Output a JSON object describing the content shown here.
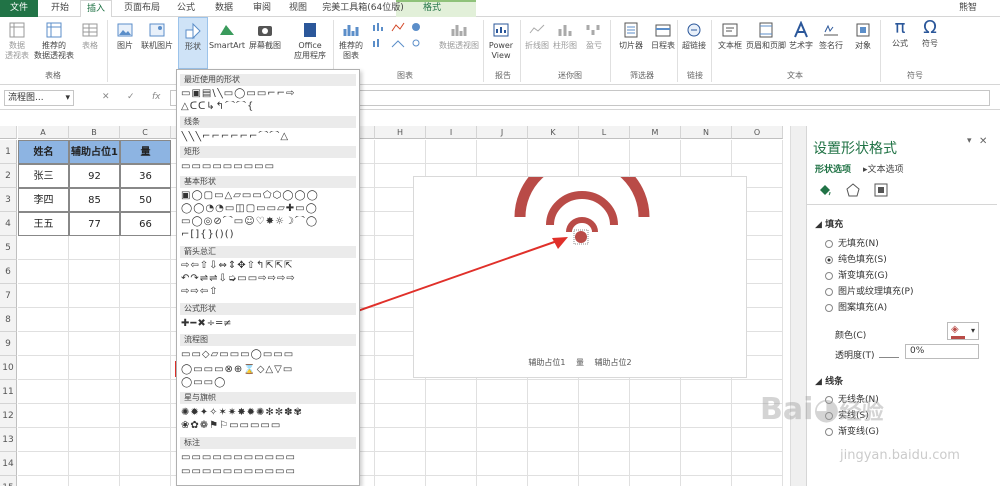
{
  "tabs": {
    "file": "文件",
    "home": "开始",
    "insert": "插入",
    "layout": "页面布局",
    "formulas": "公式",
    "data": "数据",
    "review": "审阅",
    "view": "视图",
    "toolbox": "完美工具箱(64位版)",
    "format": "格式",
    "user": "熊智"
  },
  "ribbon": {
    "pivot": "数据\n透视表",
    "rec_pivot": "推荐的\n数据透视表",
    "table": "表格",
    "pictures": "图片",
    "online_pic": "联机图片",
    "shapes": "形状",
    "smartart": "SmartArt",
    "screenshot": "屏幕截图",
    "office_apps": "Office\n应用程序",
    "rec_charts": "推荐的\n图表",
    "pivot_chart": "数据透视图",
    "power_view": "Power\nView",
    "line": "折线图",
    "column": "柱形图",
    "winloss": "盈亏",
    "slicer": "切片器",
    "timeline": "日程表",
    "hyperlink": "超链接",
    "textbox": "文本框",
    "header_footer": "页眉和页脚",
    "wordart": "艺术字",
    "signature": "签名行",
    "object": "对象",
    "equation": "公式",
    "symbol": "符号",
    "groups": {
      "tables": "表格",
      "charts": "图表",
      "reports": "报告",
      "sparklines": "迷你图",
      "filters": "筛选器",
      "links": "链接",
      "text": "文本",
      "symbols": "符号"
    }
  },
  "formula_bar": {
    "name_box": "流程图...",
    "cancel": "✕",
    "enter": "✓",
    "fx": "fx"
  },
  "columns": [
    "A",
    "B",
    "C",
    "D",
    "E",
    "F",
    "G",
    "H",
    "I",
    "J",
    "K",
    "L",
    "M",
    "N",
    "O"
  ],
  "rows": [
    "1",
    "2",
    "3",
    "4",
    "5",
    "6",
    "7",
    "8",
    "9",
    "10",
    "11",
    "12",
    "13",
    "14",
    "15"
  ],
  "table": {
    "headers": [
      "姓名",
      "辅助占位1",
      "量"
    ],
    "rows": [
      [
        "张三",
        "92",
        "36"
      ],
      [
        "李四",
        "85",
        "50"
      ],
      [
        "王五",
        "77",
        "66"
      ]
    ]
  },
  "chart": {
    "legend": [
      "辅助占位1",
      "量",
      "辅助占位2"
    ],
    "arc_color": "#b94b47"
  },
  "shapes_menu": {
    "recent": "最近使用的形状",
    "lines": "线条",
    "rect": "矩形",
    "basic": "基本形状",
    "arrows": "箭头总汇",
    "equation": "公式形状",
    "flowchart": "流程图",
    "stars": "星与旗帜",
    "callouts": "标注",
    "recent_row1": "▭▣▤\\╲▭◯▭▭⌐⌐⇨",
    "recent_row2": "△ᑕᑕ↳↰⌒⌒{",
    "lines_row": "╲╲╲⌐⌐⌐⌐⌐⌐⌒⌒△",
    "rect_row": "▭▭▭▭▭▭▭▭▭",
    "basic_row1": "▣◯▢▭△▱▭▭⬠⬡◯◯◯",
    "basic_row2": "◯◯◔◔▭◫▢▭▭▱✚▭◯",
    "basic_row3": "▭◯◎⊘⌒▭☺♡✸☼☽⌒◯",
    "basic_row4": "⌐[]{}()()",
    "arrows_row1": "⇨⇦⇧⇩⇔⇕✥⇧↰⇱⇱⇱",
    "arrows_row2": "↶↷⇌⇌⇩➭▭▭⇨⇨⇨⇨",
    "arrows_row3": "⇨⇨⇦⇧",
    "eq_row": "✚━✖÷═≠",
    "flow_row1": "▭▭◇▱▭▭▭◯▭▭▭",
    "flow_row2": "◯▭▭▭⊗⊕⌛◇△▽▭",
    "flow_row3": "◯▭▭◯",
    "star_row1": "✺✹✦✧✶✷✸✹✺✻✼✽✾",
    "star_row2": "❀✿❁⚑⚐▭▭▭▭▭",
    "call_row1": "▭▭▭▭▭▭▭▭▭▭▭",
    "call_row2": "▭▭▭▭▭▭▭▭▭▭▭"
  },
  "pane": {
    "title": "设置形状格式",
    "tab_shape": "形状选项",
    "tab_text": "文本选项",
    "fill": "填充",
    "no_fill": "无填充(N)",
    "solid": "纯色填充(S)",
    "gradient": "渐变填充(G)",
    "picture": "图片或纹理填充(P)",
    "pattern": "图案填充(A)",
    "color": "颜色(C)",
    "transparency": "透明度(T)",
    "transparency_val": "0%",
    "line": "线条",
    "no_line": "无线条(N)",
    "solid_line": "实线(S)",
    "grad_line": "渐变线(G)"
  },
  "watermark": {
    "brand": "Bai",
    "brand2": "经验",
    "url": "jingyan.baidu.com"
  }
}
